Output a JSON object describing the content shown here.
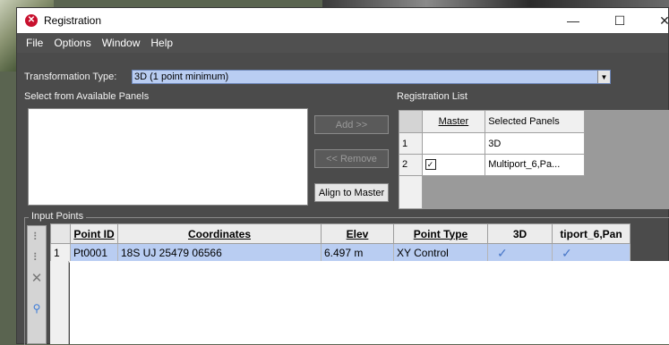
{
  "window": {
    "title": "Registration"
  },
  "titlebar_controls": {
    "minimize": "—",
    "maximize": "☐",
    "close": "✕"
  },
  "menu": [
    "File",
    "Options",
    "Window",
    "Help"
  ],
  "transformation": {
    "label": "Transformation Type:",
    "value": "3D (1 point minimum)"
  },
  "available_panels": {
    "label": "Select from Available Panels"
  },
  "buttons": {
    "add": "Add >>",
    "remove": "<< Remove",
    "align": "Align to Master"
  },
  "registration_list": {
    "label": "Registration List",
    "headers": [
      "Master",
      "Selected Panels"
    ],
    "rows": [
      {
        "num": "1",
        "master_checked": false,
        "panel": "3D"
      },
      {
        "num": "2",
        "master_checked": true,
        "panel": "Multiport_6,Pa..."
      }
    ]
  },
  "input_points": {
    "label": "Input Points",
    "headers": [
      "Point ID",
      "Coordinates",
      "Elev",
      "Point Type",
      "3D",
      "tiport_6,Pan"
    ],
    "rows": [
      {
        "num": "1",
        "point_id": "Pt0001",
        "coordinates": "18S UJ 25479 06566",
        "elev": "6.497 m",
        "point_type": "XY Control",
        "c3d": "✓",
        "cmulti": "✓"
      }
    ]
  },
  "colors": {
    "window_bg": "#4b4b4b",
    "selection": "#b9cdf2",
    "app_icon": "#c8102e"
  }
}
